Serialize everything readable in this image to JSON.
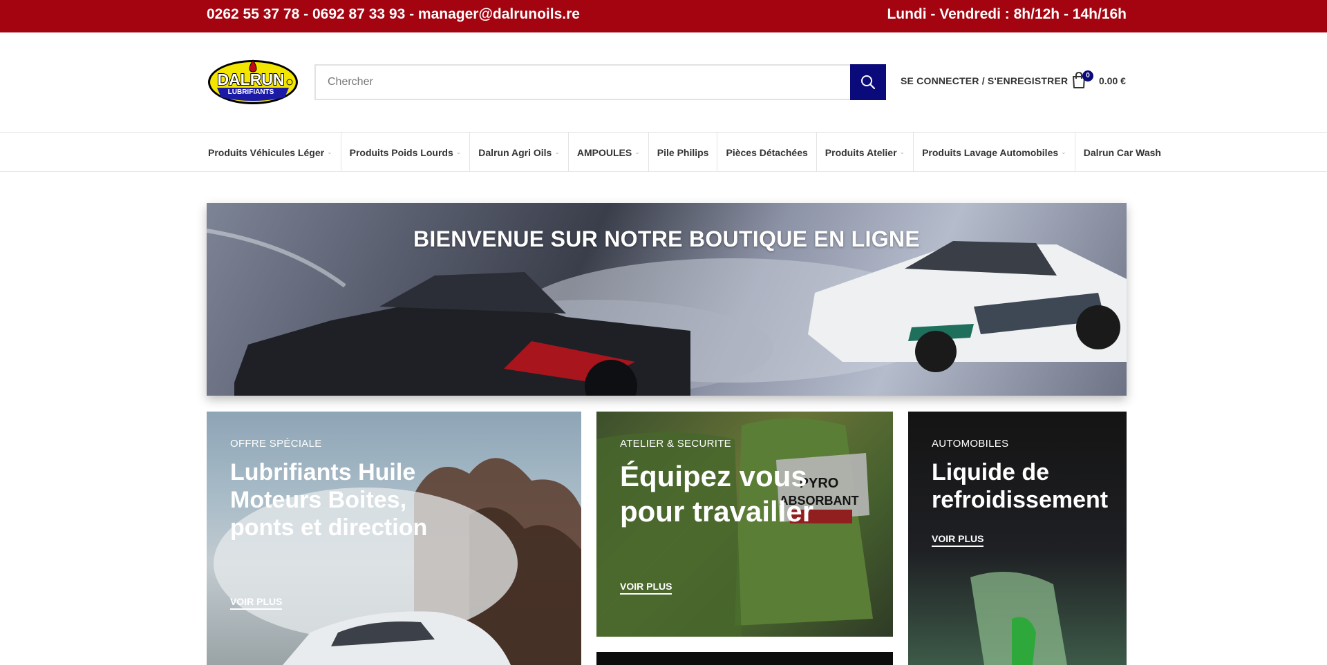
{
  "topbar": {
    "contact": "0262 55 37 78 - 0692 87 33 93 - manager@dalrunoils.re",
    "hours": "Lundi - Vendredi : 8h/12h - 14h/16h"
  },
  "header": {
    "logo_text": "DALRUN",
    "logo_subtext": "LUBRIFIANTS",
    "search_placeholder": "Chercher",
    "login_label": "SE CONNECTER / S'ENREGISTRER",
    "cart_count": "0",
    "cart_total": "0.00 €"
  },
  "nav": {
    "items": [
      {
        "label": "Produits Véhicules Léger",
        "has_dropdown": true
      },
      {
        "label": "Produits Poids Lourds",
        "has_dropdown": true
      },
      {
        "label": "Dalrun Agri Oils",
        "has_dropdown": true
      },
      {
        "label": "AMPOULES",
        "has_dropdown": true
      },
      {
        "label": "Pile Philips",
        "has_dropdown": false
      },
      {
        "label": "Pièces Détachées",
        "has_dropdown": false
      },
      {
        "label": "Produits Atelier",
        "has_dropdown": true
      },
      {
        "label": "Produits Lavage Automobiles",
        "has_dropdown": true
      },
      {
        "label": "Dalrun Car Wash",
        "has_dropdown": false
      }
    ]
  },
  "hero": {
    "title": "BIENVENUE SUR NOTRE BOUTIQUE EN LIGNE"
  },
  "cards": [
    {
      "kicker": "OFFRE SPÉCIALE",
      "heading": "Lubrifiants Huile Moteurs Boites, ponts et direction",
      "more": "VOIR PLUS"
    },
    {
      "kicker": "ATELIER & SECURITE",
      "heading": "Équipez vous pour travailler",
      "more": "VOIR PLUS"
    },
    {
      "kicker": "AUTOMOBILES",
      "heading": "Liquide de refroidissement",
      "more": "VOIR PLUS"
    }
  ],
  "colors": {
    "topbar": "#a30410",
    "accent": "#0a0a7a",
    "logo_yellow": "#f2e600"
  }
}
